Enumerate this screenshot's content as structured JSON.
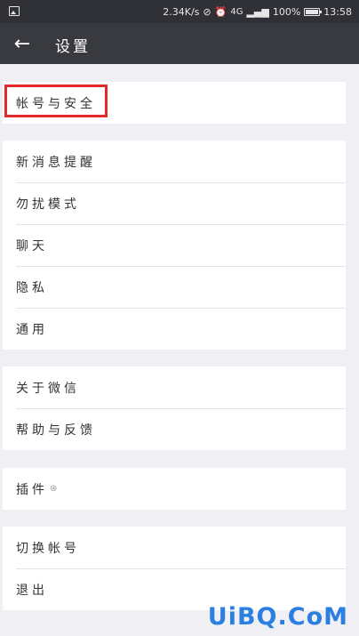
{
  "status_bar": {
    "speed": "2.34K/s",
    "network": "4G",
    "battery": "100%",
    "time": "13:58"
  },
  "header": {
    "title": "设置"
  },
  "groups": [
    {
      "items": [
        {
          "label": "帐号与安全"
        }
      ]
    },
    {
      "items": [
        {
          "label": "新消息提醒"
        },
        {
          "label": "勿扰模式"
        },
        {
          "label": "聊天"
        },
        {
          "label": "隐私"
        },
        {
          "label": "通用"
        }
      ]
    },
    {
      "items": [
        {
          "label": "关于微信"
        },
        {
          "label": "帮助与反馈"
        }
      ]
    },
    {
      "items": [
        {
          "label": "插件"
        }
      ]
    },
    {
      "items": [
        {
          "label": "切换帐号"
        },
        {
          "label": "退出"
        }
      ]
    }
  ],
  "watermark": "UiBQ.CoM",
  "colors": {
    "highlight": "#e5282b",
    "app_bar": "#393a3f",
    "watermark": "#2b7fe0"
  }
}
